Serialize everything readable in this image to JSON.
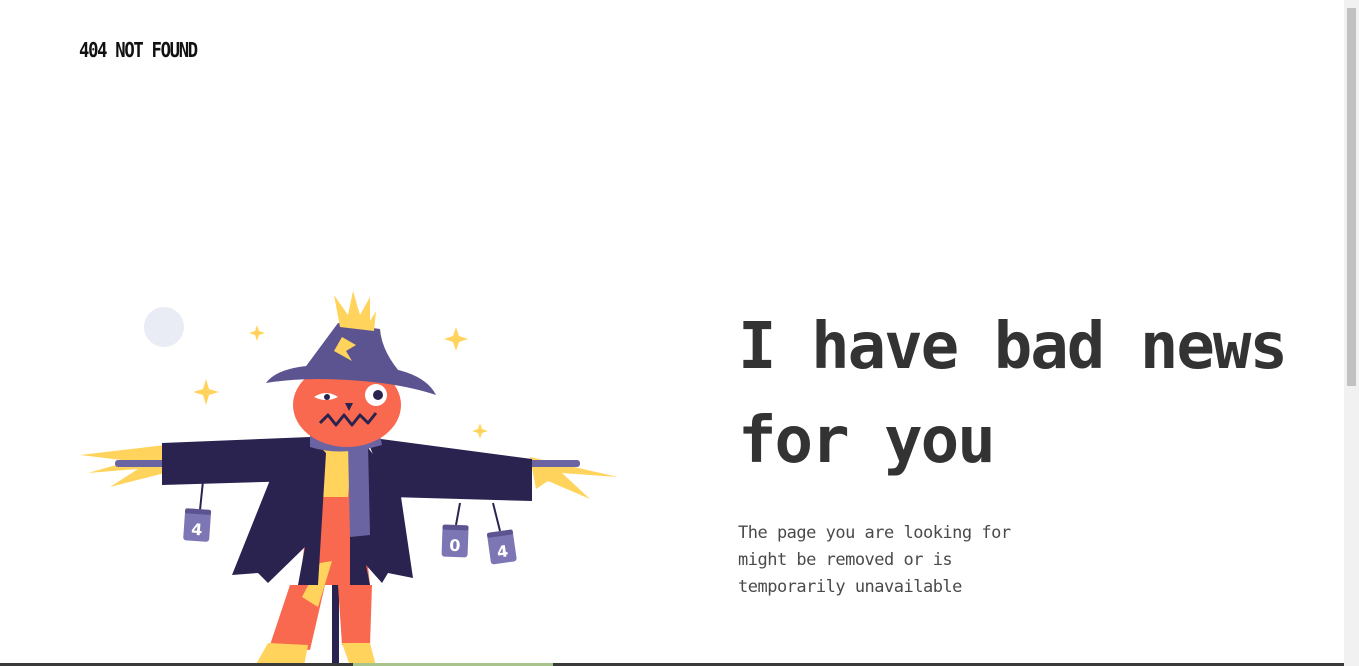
{
  "header": {
    "brand": "404 NOT FOUND"
  },
  "main": {
    "headline": "I have bad news for you",
    "message": "The page you are looking for might be removed or is temporarily unavailable"
  },
  "illustration": {
    "subject": "scarecrow",
    "can_labels": [
      "4",
      "0",
      "4"
    ]
  },
  "colors": {
    "text_dark": "#333333",
    "hat": "#5c5490",
    "coat": "#2a2350",
    "face": "#f9694f",
    "straw": "#ffd35c",
    "moon": "#e9ebf5"
  }
}
